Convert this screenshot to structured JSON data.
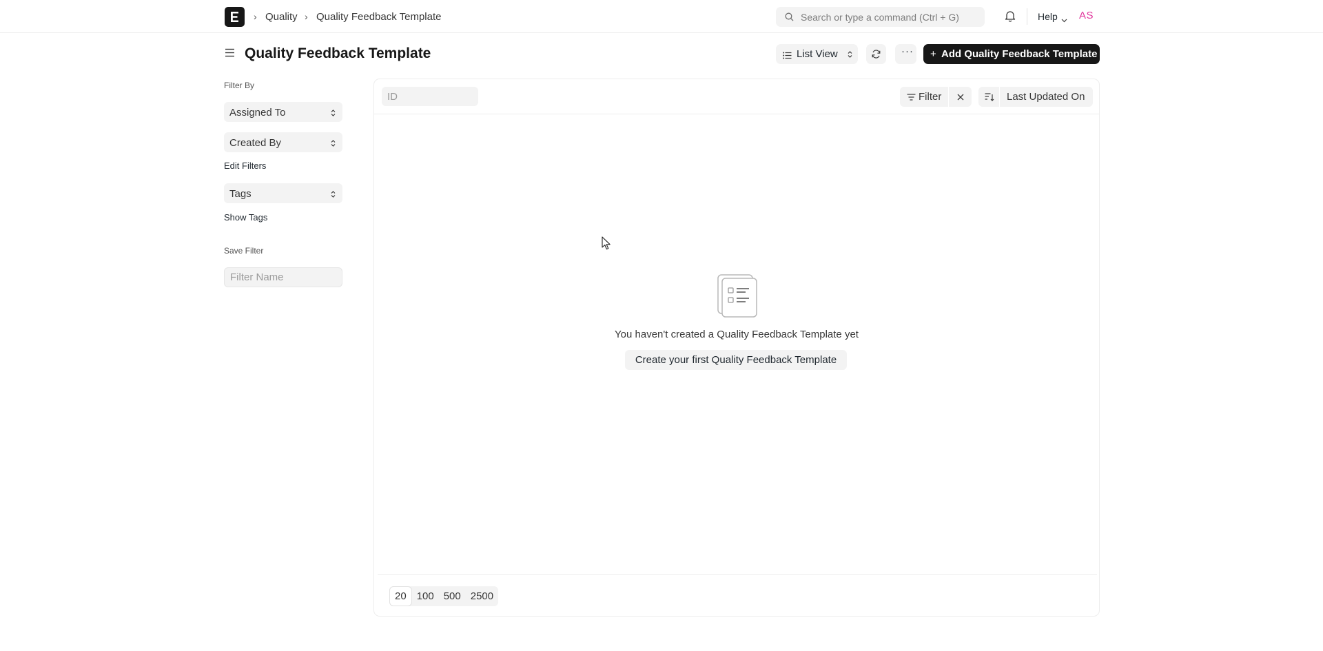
{
  "navbar": {
    "breadcrumbs": [
      "Quality",
      "Quality Feedback Template"
    ],
    "search_placeholder": "Search or type a command (Ctrl + G)",
    "help_label": "Help",
    "avatar_initials": "AS"
  },
  "header": {
    "title": "Quality Feedback Template",
    "view_switcher_label": "List View",
    "more_label": "···",
    "primary_button_label": "Add Quality Feedback Template",
    "primary_button_plus": "+"
  },
  "sidebar": {
    "filter_by_label": "Filter By",
    "assigned_to_label": "Assigned To",
    "created_by_label": "Created By",
    "edit_filters_label": "Edit Filters",
    "tags_label": "Tags",
    "show_tags_label": "Show Tags",
    "save_filter_label": "Save Filter",
    "filter_name_placeholder": "Filter Name"
  },
  "list": {
    "id_placeholder": "ID",
    "filter_label": "Filter",
    "sort_label": "Last Updated On",
    "empty_message": "You haven't created a Quality Feedback Template yet",
    "empty_button_label": "Create your first Quality Feedback Template",
    "page_sizes": [
      "20",
      "100",
      "500",
      "2500"
    ],
    "active_page_size": "20"
  },
  "colors": {
    "primary": "#171717",
    "avatar_text": "#e0349b",
    "control_bg": "#f3f3f3",
    "border": "#ededed"
  }
}
